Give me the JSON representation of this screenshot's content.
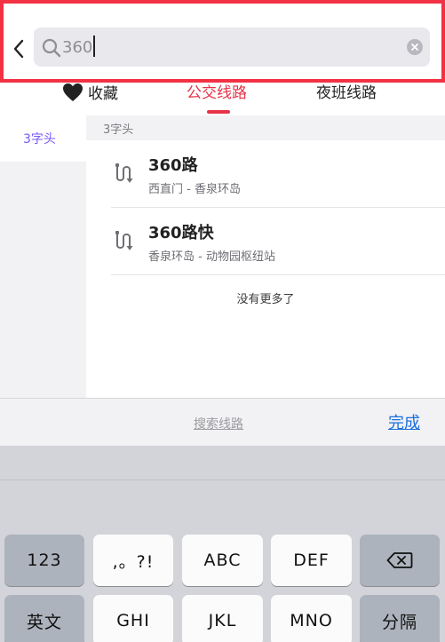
{
  "search": {
    "value": "360",
    "back_icon": "chevron-left-icon",
    "search_icon": "magnifier-icon",
    "clear_icon": "clear-circle-icon"
  },
  "tabs": [
    {
      "label": "收藏",
      "icon": "heart-icon",
      "selected": false
    },
    {
      "label": "公交线路",
      "selected": true
    },
    {
      "label": "夜班线路",
      "selected": false
    }
  ],
  "sidebar": {
    "items": [
      {
        "label": "3字头",
        "selected": true
      }
    ]
  },
  "results": {
    "group_header": "3字头",
    "routes": [
      {
        "name": "360路",
        "stops": "西直门 - 香泉环岛",
        "icon": "route-icon"
      },
      {
        "name": "360路快",
        "stops": "香泉环岛 - 动物园枢纽站",
        "icon": "route-icon"
      }
    ],
    "end_text": "没有更多了"
  },
  "action_bar": {
    "search_route": "搜索线路",
    "done": "完成"
  },
  "keyboard": {
    "row1": [
      "123",
      ",。?!",
      "ABC",
      "DEF"
    ],
    "delete_icon": "backspace-icon",
    "row2": [
      "英文",
      "GHI",
      "JKL",
      "MNO",
      "分隔"
    ]
  },
  "colors": {
    "header_border": "#f23244",
    "active_tab": "#e63347",
    "sidebar_accent": "#7a5af8",
    "link_blue": "#1b6fe0"
  }
}
